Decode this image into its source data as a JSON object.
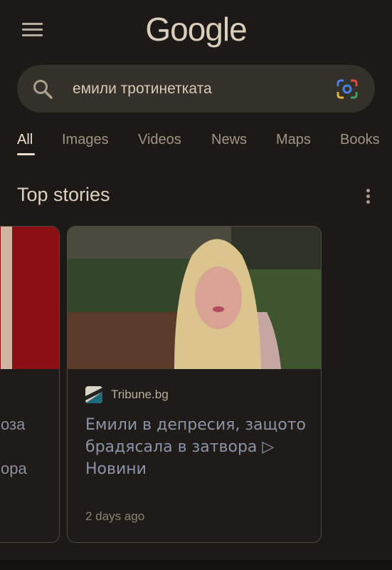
{
  "header": {
    "logo": "Google"
  },
  "search": {
    "query": "емили тротинетката"
  },
  "tabs": [
    {
      "label": "All"
    },
    {
      "label": "Images"
    },
    {
      "label": "Videos"
    },
    {
      "label": "News"
    },
    {
      "label": "Maps"
    },
    {
      "label": "Books"
    }
  ],
  "top_stories": {
    "title": "Top stories",
    "partial_card": {
      "line1": "оза",
      "line2": "ора"
    },
    "card": {
      "source": "Tribune.bg",
      "headline": "Емили в депресия, защото брадясала в затвора ▷ Новини",
      "time": "2 days ago"
    }
  },
  "colors": {
    "background": "#1c1917",
    "search_bg": "#34302a",
    "headline": "#8d93a6",
    "accent_red": "#8a1016"
  }
}
